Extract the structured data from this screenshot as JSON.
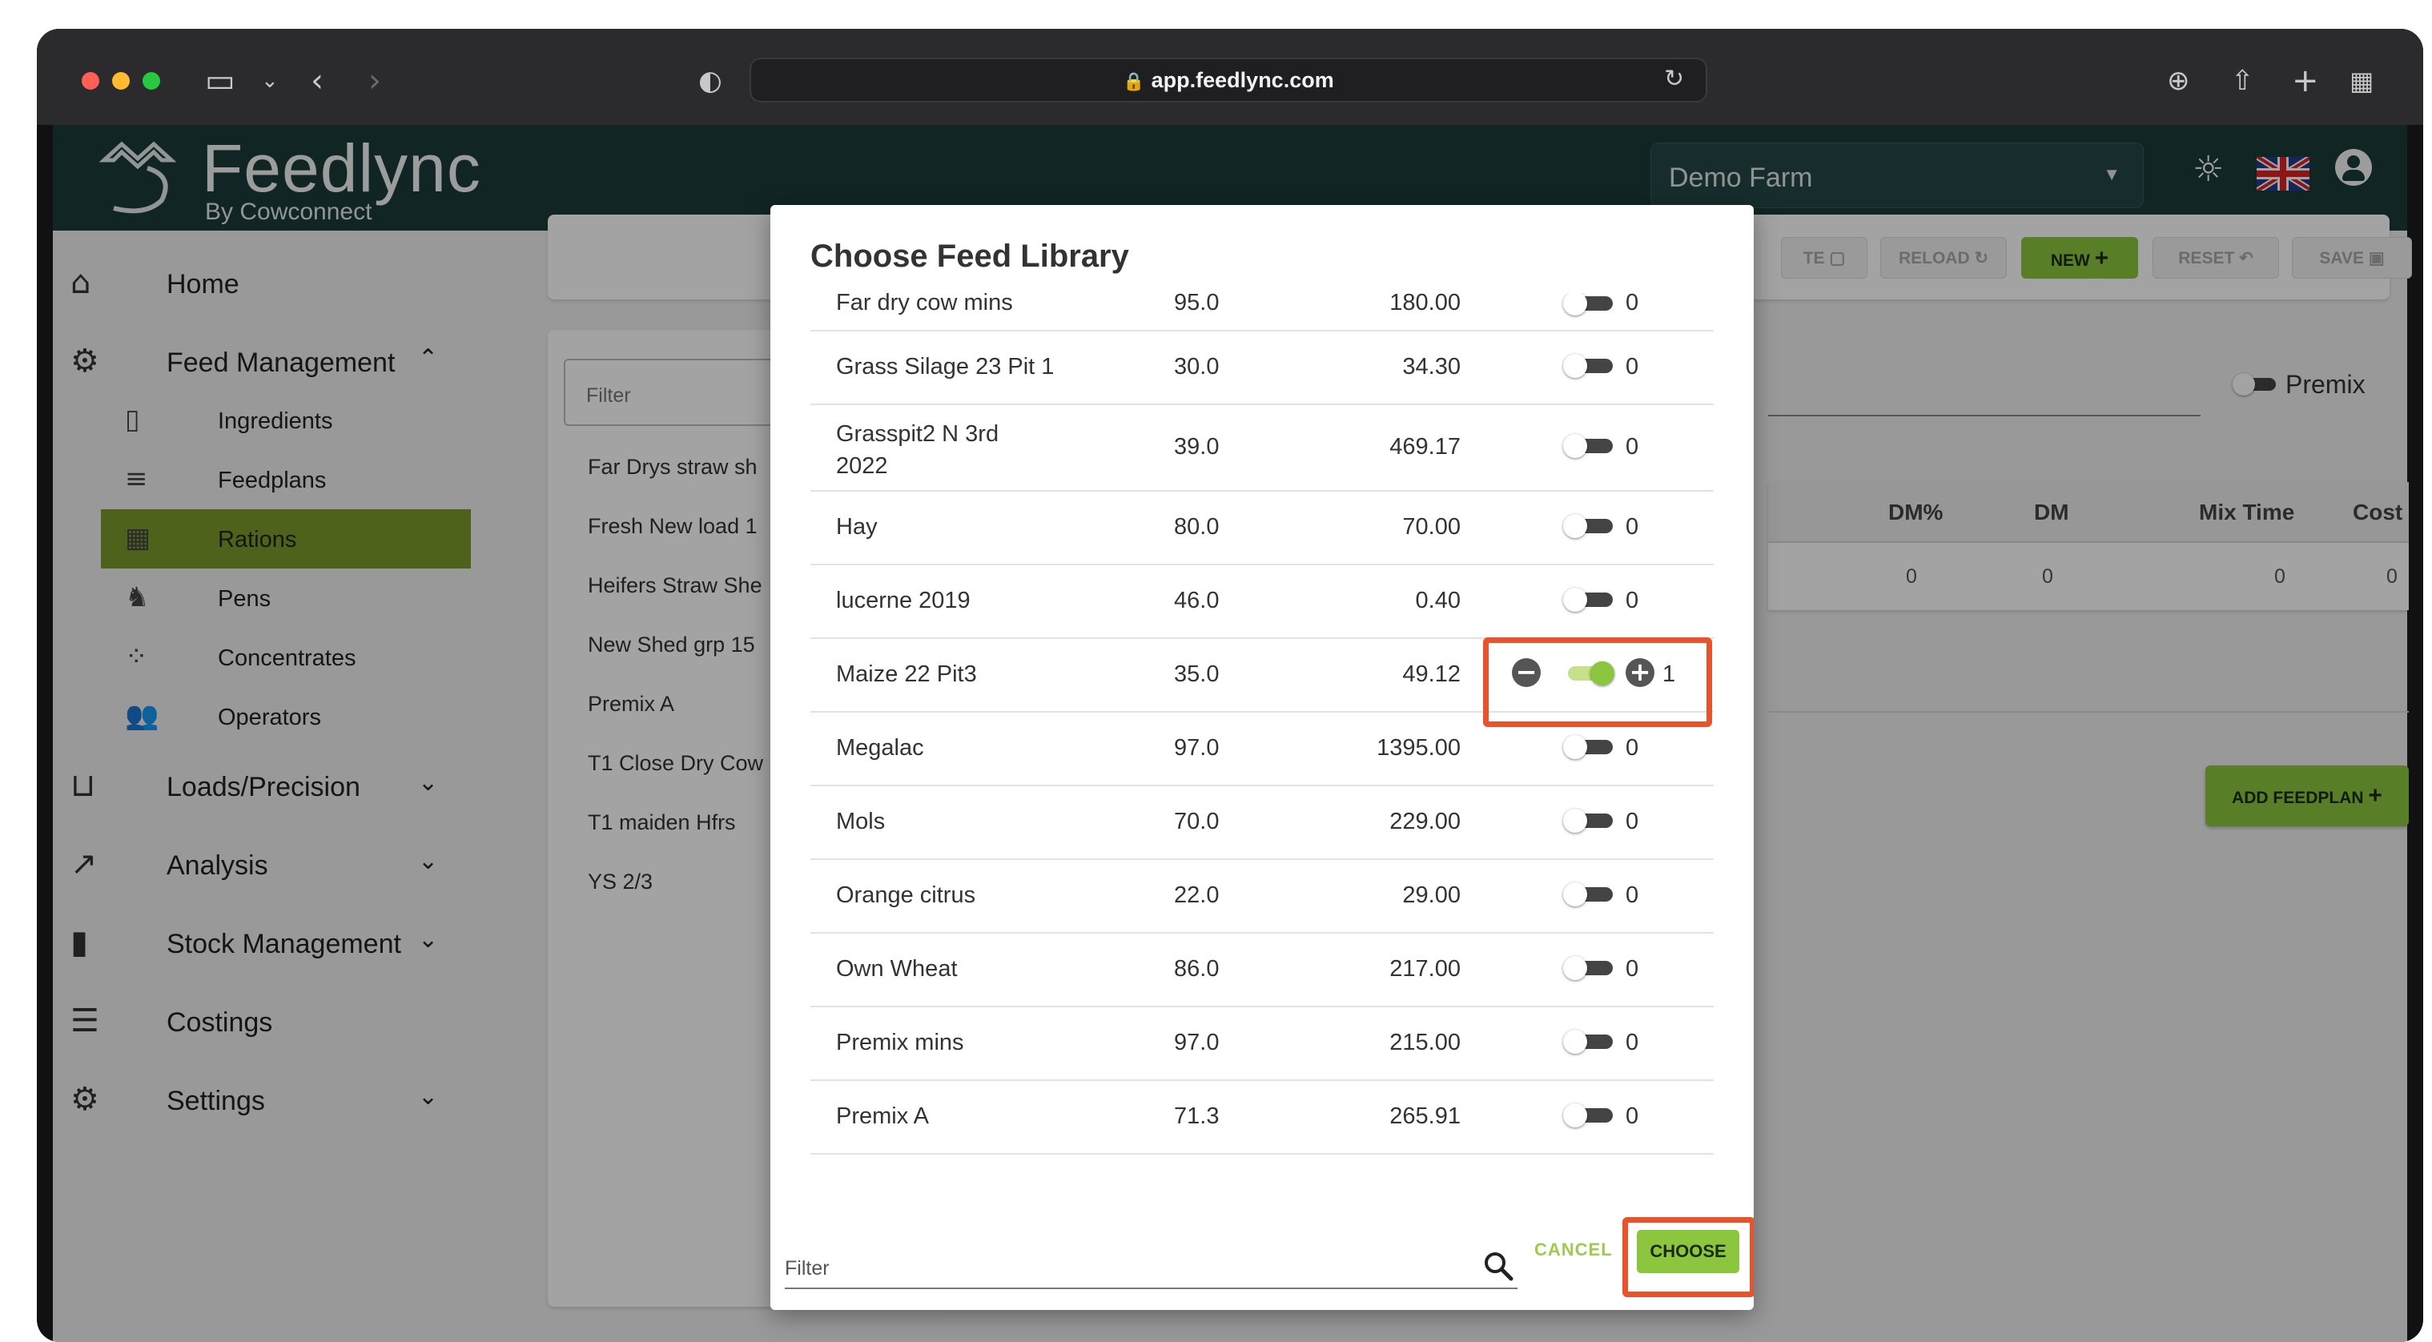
{
  "browser": {
    "url": "app.feedlync.com"
  },
  "app": {
    "logo_title": "Feedlync",
    "logo_subtitle": "By Cowconnect",
    "farm_select_value": "Demo Farm"
  },
  "sidebar": {
    "items": [
      {
        "label": "Home",
        "icon": "home-icon"
      },
      {
        "label": "Feed Management",
        "icon": "feed-management-icon",
        "expanded": true
      },
      {
        "label": "Loads/Precision",
        "icon": "loads-icon"
      },
      {
        "label": "Analysis",
        "icon": "analysis-icon"
      },
      {
        "label": "Stock Management",
        "icon": "stock-icon"
      },
      {
        "label": "Costings",
        "icon": "costings-icon"
      },
      {
        "label": "Settings",
        "icon": "settings-icon"
      }
    ],
    "sub_items": [
      {
        "label": "Ingredients",
        "icon": "ingredients-icon"
      },
      {
        "label": "Feedplans",
        "icon": "feedplans-icon"
      },
      {
        "label": "Rations",
        "icon": "rations-icon",
        "active": true
      },
      {
        "label": "Pens",
        "icon": "pens-icon"
      },
      {
        "label": "Concentrates",
        "icon": "concentrates-icon"
      },
      {
        "label": "Operators",
        "icon": "operators-icon"
      }
    ]
  },
  "toolbar": {
    "duplicate_label": "TE",
    "reload_label": "RELOAD",
    "new_label": "NEW",
    "reset_label": "RESET",
    "save_label": "SAVE"
  },
  "main": {
    "filter_placeholder": "Filter",
    "rations": [
      "Far Drys straw sh",
      "Fresh New load 1",
      "Heifers Straw She",
      "New Shed grp 15",
      "Premix A",
      "T1 Close Dry Cow",
      "T1 maiden Hfrs",
      "YS 2/3"
    ],
    "premix_label": "Premix",
    "columns": [
      "DM%",
      "DM",
      "Mix Time",
      "Cost"
    ],
    "values": [
      "0",
      "0",
      "0",
      "0"
    ],
    "add_feedplan_label": "ADD FEEDPLAN"
  },
  "dialog": {
    "title": "Choose Feed Library",
    "partial_row": {
      "name": "Far dry cow mins",
      "dm": "95.0",
      "price": "180.00",
      "qty": "0"
    },
    "rows": [
      {
        "name": "Grass Silage 23 Pit 1",
        "dm": "30.0",
        "price": "34.30",
        "qty": "0",
        "on": false
      },
      {
        "name": "Grasspit2 N 3rd 2022",
        "dm": "39.0",
        "price": "469.17",
        "qty": "0",
        "on": false
      },
      {
        "name": "Hay",
        "dm": "80.0",
        "price": "70.00",
        "qty": "0",
        "on": false
      },
      {
        "name": "lucerne 2019",
        "dm": "46.0",
        "price": "0.40",
        "qty": "0",
        "on": false
      },
      {
        "name": "Maize 22 Pit3",
        "dm": "35.0",
        "price": "49.12",
        "qty": "1",
        "on": true
      },
      {
        "name": "Megalac",
        "dm": "97.0",
        "price": "1395.00",
        "qty": "0",
        "on": false
      },
      {
        "name": "Mols",
        "dm": "70.0",
        "price": "229.00",
        "qty": "0",
        "on": false
      },
      {
        "name": "Orange citrus",
        "dm": "22.0",
        "price": "29.00",
        "qty": "0",
        "on": false
      },
      {
        "name": "Own Wheat",
        "dm": "86.0",
        "price": "217.00",
        "qty": "0",
        "on": false
      },
      {
        "name": "Premix mins",
        "dm": "97.0",
        "price": "215.00",
        "qty": "0",
        "on": false
      },
      {
        "name": "Premix A",
        "dm": "71.3",
        "price": "265.91",
        "qty": "0",
        "on": false
      }
    ],
    "filter_placeholder": "Filter",
    "cancel_label": "CANCEL",
    "choose_label": "CHOOSE"
  },
  "colors": {
    "accent_green": "#8cc63f",
    "active_nav": "#7a9a2c",
    "header_teal": "#1c3a3a",
    "highlight": "#e8532b"
  }
}
